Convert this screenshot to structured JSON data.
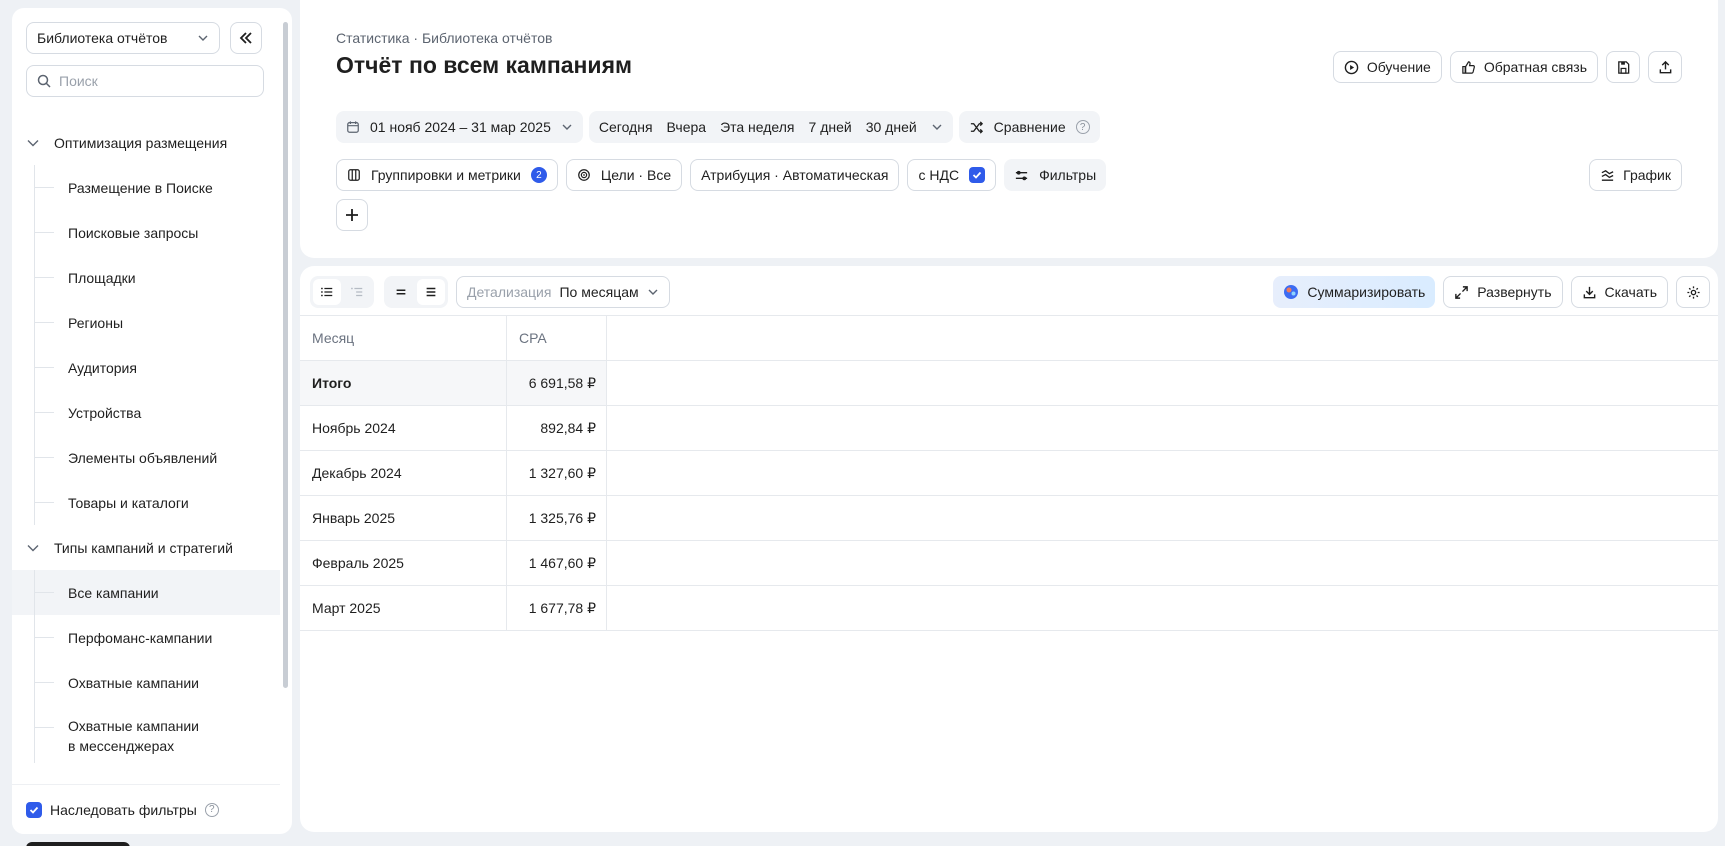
{
  "sidebar": {
    "library_select": "Библиотека отчётов",
    "search_placeholder": "Поиск",
    "groups": [
      {
        "label": "Оптимизация размещения",
        "items": [
          "Размещение в Поиске",
          "Поисковые запросы",
          "Площадки",
          "Регионы",
          "Аудитория",
          "Устройства",
          "Элементы объявлений",
          "Товары и каталоги"
        ]
      },
      {
        "label": "Типы кампаний и стратегий",
        "items": [
          "Все кампании",
          "Перфоманс-кампании",
          "Охватные кампании",
          "Охватные кампании\nв мессенджерах"
        ]
      }
    ],
    "active_item": "Все кампании",
    "inherit_filters": "Наследовать фильтры"
  },
  "header": {
    "breadcrumb": "Статистика · Библиотека отчётов",
    "title": "Отчёт по всем кампаниям",
    "actions": {
      "learning": "Обучение",
      "feedback": "Обратная связь"
    },
    "date_range": "01 нояб 2024 – 31 мар 2025",
    "quick_periods": [
      "Сегодня",
      "Вчера",
      "Эта неделя",
      "7 дней",
      "30 дней"
    ],
    "compare": "Сравнение",
    "groupings": "Группировки и метрики",
    "groupings_count": "2",
    "goals": "Цели · Все",
    "attribution": "Атрибуция · Автоматическая",
    "vat": "с НДС",
    "filters": "Фильтры",
    "chart": "График"
  },
  "toolbar": {
    "detail_label": "Детализация",
    "detail_value": "По месяцам",
    "summarize": "Суммаризировать",
    "expand": "Развернуть",
    "download": "Скачать"
  },
  "table": {
    "columns": [
      "Месяц",
      "CPA"
    ],
    "total": {
      "label": "Итого",
      "value": "6 691,58 ₽"
    },
    "rows": [
      {
        "month": "Ноябрь 2024",
        "cpa": "892,84 ₽"
      },
      {
        "month": "Декабрь 2024",
        "cpa": "1 327,60 ₽"
      },
      {
        "month": "Январь 2025",
        "cpa": "1 325,76 ₽"
      },
      {
        "month": "Февраль 2025",
        "cpa": "1 467,60 ₽"
      },
      {
        "month": "Март 2025",
        "cpa": "1 677,78 ₽"
      }
    ]
  },
  "colors": {
    "accent": "#2f5bea",
    "page_bg": "#eef1f5"
  }
}
